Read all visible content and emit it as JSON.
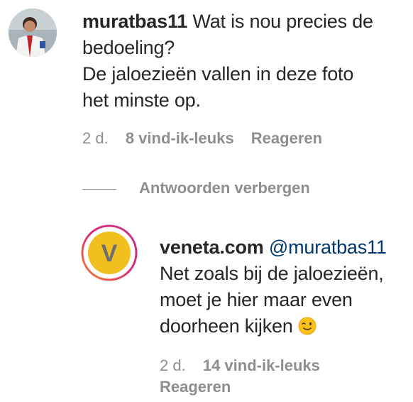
{
  "comment": {
    "username": "muratbas11",
    "text_line1": "Wat is nou precies de",
    "text_line2": "bedoeling?",
    "text_line3": "De jaloezieën vallen in deze foto",
    "text_line4": "het minste op.",
    "time": "2 d.",
    "likes": "8 vind-ik-leuks",
    "reply_label": "Reageren"
  },
  "replies_toggle": {
    "label": "Antwoorden verbergen"
  },
  "reply": {
    "username": "veneta.com",
    "avatar_letter": "V",
    "mention": "@muratbas11",
    "text_line1": "Net zoals bij de jaloezieën,",
    "text_line2": "moet je hier maar even",
    "text_line3": "doorheen kijken",
    "emoji_icon": "winking-face-icon",
    "time": "2 d.",
    "likes": "14 vind-ik-leuks",
    "reply_label": "Reageren"
  },
  "colors": {
    "text": "#262626",
    "secondary": "#8e8e8e",
    "mention": "#00376b",
    "avatar_yellow": "#f2c01e",
    "story_ring_start": "#f58529",
    "story_ring_end": "#dd2a7b"
  }
}
